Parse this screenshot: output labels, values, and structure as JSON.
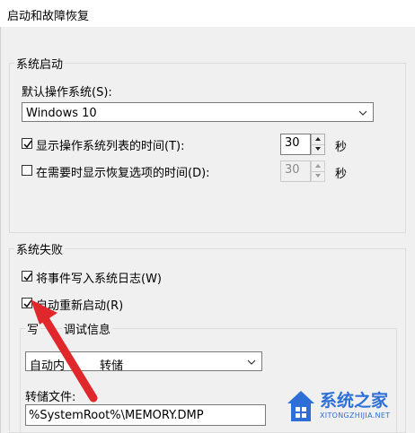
{
  "window": {
    "title": "启动和故障恢复"
  },
  "system_startup": {
    "group_label": "系统启动",
    "default_os_label": "默认操作系统(S):",
    "default_os_value": "Windows 10",
    "show_os_list": {
      "label": "显示操作系统列表的时间(T):",
      "checked": true,
      "value": "30",
      "unit": "秒"
    },
    "show_recovery": {
      "label": "在需要时显示恢复选项的时间(D):",
      "checked": false,
      "value": "30",
      "unit": "秒"
    }
  },
  "system_failure": {
    "group_label": "系统失败",
    "write_event_log": {
      "label": "将事件写入系统日志(W)",
      "checked": true
    },
    "auto_restart": {
      "label": "自动重新启动(R)",
      "checked": true
    },
    "debug_info": {
      "group_label_left": "写",
      "group_label_right": "调试信息",
      "dump_type_left": "自动内",
      "dump_type_right": "转储",
      "dump_file_label": "转储文件:",
      "dump_file_value": "%SystemRoot%\\MEMORY.DMP"
    }
  },
  "watermark": {
    "text": "系统之家",
    "url": "XITONGZHIJIA.NET"
  },
  "colors": {
    "dialog_bg": "#f0f0f0",
    "arrow": "#e0272c",
    "watermark": "#2d6fd6"
  }
}
